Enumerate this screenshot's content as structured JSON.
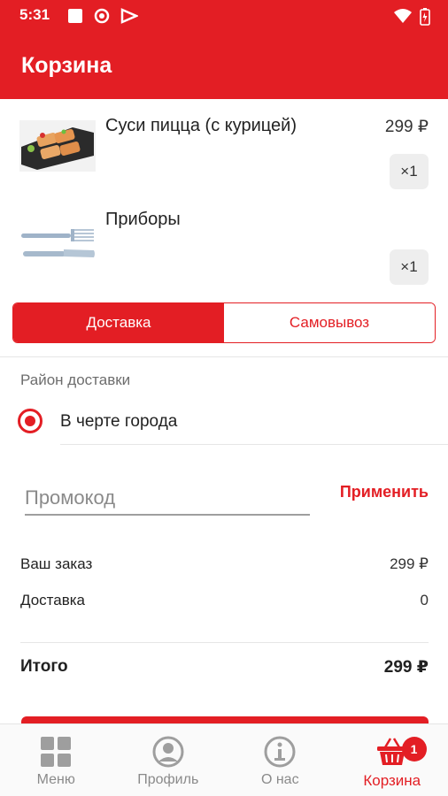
{
  "status_bar": {
    "time": "5:31"
  },
  "app_bar": {
    "title": "Корзина",
    "accent_color": "#e31e24"
  },
  "cart_items": [
    {
      "name": "Суси пицца (с курицей)",
      "price": "299 ₽",
      "quantity": "×1",
      "image_icon": "sushi-pizza-image"
    },
    {
      "name": "Приборы",
      "price": "",
      "quantity": "×1",
      "image_icon": "cutlery-image"
    }
  ],
  "delivery_toggle": {
    "options": [
      "Доставка",
      "Самовывоз"
    ],
    "selected": "Доставка"
  },
  "delivery_area": {
    "label": "Район доставки",
    "option": "В черте города",
    "selected": true
  },
  "promo": {
    "placeholder": "Промокод",
    "value": "",
    "apply_label": "Применить"
  },
  "summary": {
    "order_label": "Ваш заказ",
    "order_value": "299 ₽",
    "delivery_label": "Доставка",
    "delivery_value": "0",
    "total_label": "Итого",
    "total_value": "299 ₽"
  },
  "bottom_nav": {
    "items": [
      {
        "label": "Меню",
        "icon": "grid-icon"
      },
      {
        "label": "Профиль",
        "icon": "person-icon"
      },
      {
        "label": "О нас",
        "icon": "info-icon"
      },
      {
        "label": "Корзина",
        "icon": "basket-icon",
        "active": true
      }
    ],
    "cart_badge": "1"
  }
}
